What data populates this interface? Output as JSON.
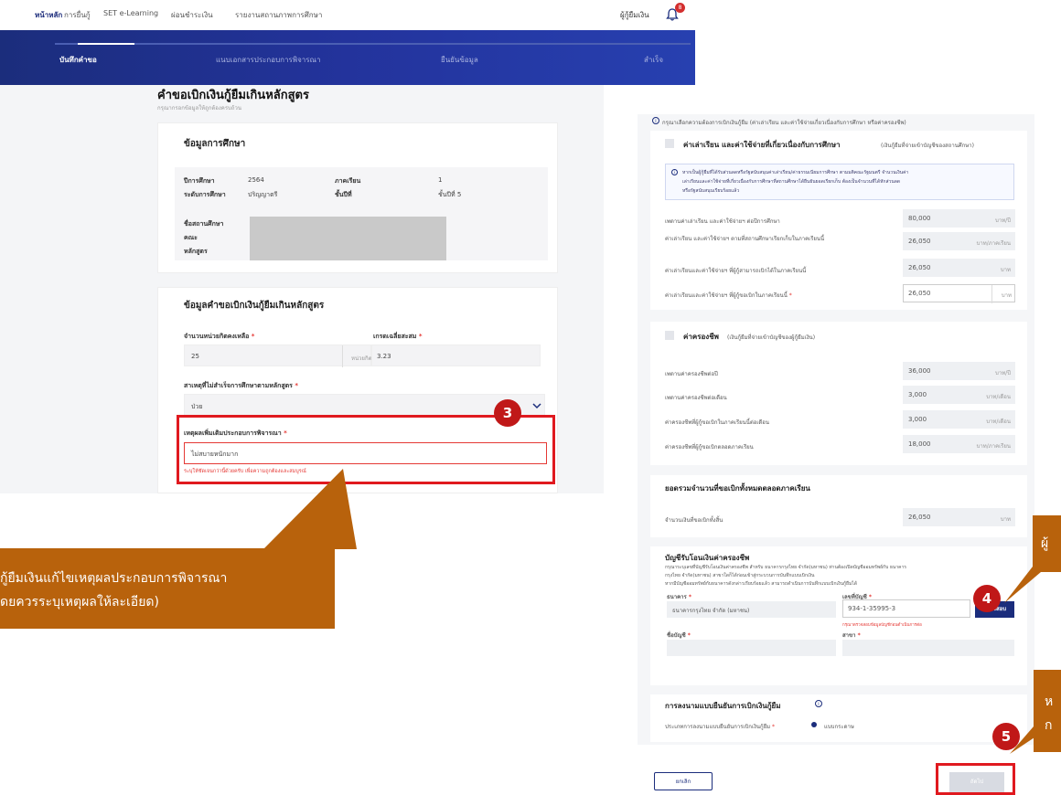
{
  "nav": {
    "items": [
      "หน้าหลัก",
      "การยื่นกู้",
      "SET e-Learning",
      "ผ่อนชำระเงิน",
      "รายงานสถานภาพการศึกษา"
    ],
    "user": "ผู้กู้ยืมเงิน",
    "badge": "8"
  },
  "stepper": {
    "steps": [
      "บันทึกคำขอ",
      "แนบเอกสารประกอบการพิจารณา",
      "ยืนยันข้อมูล",
      "สำเร็จ"
    ]
  },
  "form": {
    "title": "คำขอเบิกเงินกู้ยืมเกินหลักสูตร",
    "subtitle": "กรุณากรอกข้อมูลให้ถูกต้องครบถ้วน",
    "edu_card": {
      "title": "ข้อมูลการศึกษา",
      "year_label": "ปีการศึกษา",
      "year_value": "2564",
      "term_label": "ภาคเรียน",
      "term_value": "1",
      "level_label": "ระดับการศึกษา",
      "level_value": "ปริญญาตรี",
      "class_label": "ชั้นปีที่",
      "class_value": "ชั้นปีที่ 5",
      "inst_label": "ชื่อสถานศึกษา",
      "faculty_label": "คณะ",
      "program_label": "หลักสูตร"
    },
    "req_card": {
      "title": "ข้อมูลคำขอเบิกเงินกู้ยืมเกินหลักสูตร",
      "credits_label": "จำนวนหน่วยกิตคงเหลือ",
      "credits_value": "25",
      "credits_unit": "หน่วยกิต",
      "gpa_label": "เกรดเฉลี่ยสะสม",
      "gpa_value": "3.23",
      "reason_label": "สาเหตุที่ไม่สำเร็จการศึกษาตามหลักสูตร",
      "reason_value": "ป่วย",
      "extra_label": "เหตุผลเพิ่มเติมประกอบการพิจารณา",
      "extra_value": "ไม่สบายหนักมาก",
      "error_text": "ระบุให้ชัดเจนกว่านี้ด้วยครับ เพื่อความถูกต้องและสมบูรณ์"
    }
  },
  "callout3": {
    "number": "3",
    "line1": "กู้ยืมเงินแก้ไขเหตุผลประกอบการพิจารณา",
    "line2": "ดยควรระบุเหตุผลให้ละเอียด)"
  },
  "callout4": {
    "number": "4",
    "text": "ผู้"
  },
  "callout5": {
    "number": "5",
    "line1": "ห",
    "line2": "ก"
  },
  "right": {
    "info_note": "กรุณาเลือกความต้องการเบิกเงินกู้ยืม (ค่าเล่าเรียน และค่าใช้จ่ายเกี่ยวเนื่องกับการศึกษา หรือค่าครองชีพ)",
    "tuition": {
      "title": "ค่าเล่าเรียน และค่าใช้จ่ายที่เกี่ยวเนื่องกับการศึกษา",
      "title_note": "(เงินกู้ยืมที่จ่ายเข้าบัญชีของสถานศึกษา)",
      "info1": "หากเป็นผู้กู้ยืมที่ได้รับส่วนลดหรือรัฐสนับสนุนค่าเล่าเรียน/ค่าธรรมเนียมการศึกษา ตามมติคณะรัฐมนตรี จำนวนเงินค่า",
      "info2": "เล่าเรียนและค่าใช้จ่ายที่เกี่ยวเนื่องกับการศึกษาที่สถานศึกษาได้ยืนยันยอดเรียกเก็บ ต้องเป็นจำนวนที่ได้หักส่วนลด",
      "info3": "หรือรัฐสนับสนุนเรียบร้อยแล้ว",
      "rows": [
        {
          "label": "เพดานค่าเล่าเรียน และค่าใช้จ่ายฯ ต่อปีการศึกษา",
          "value": "80,000",
          "unit": "บาท/ปี"
        },
        {
          "label": "ค่าเล่าเรียน และค่าใช้จ่ายฯ ตามที่สถานศึกษาเรียกเก็บในภาคเรียนนี้",
          "value": "26,050",
          "unit": "บาท/ภาคเรียน"
        },
        {
          "label": "ค่าเล่าเรียนและค่าใช้จ่ายฯ ที่ผู้กู้สามารถเบิกได้ในภาคเรียนนี้",
          "value": "26,050",
          "unit": "บาท"
        },
        {
          "label": "ค่าเล่าเรียนและค่าใช้จ่ายฯ ที่ผู้กู้ขอเบิกในภาคเรียนนี้",
          "value": "26,050",
          "unit": "บาท"
        }
      ]
    },
    "living": {
      "title": "ค่าครองชีพ",
      "title_note": "(เงินกู้ยืมที่จ่ายเข้าบัญชีของผู้กู้ยืมเงิน)",
      "rows": [
        {
          "label": "เพดานค่าครองชีพต่อปี",
          "value": "36,000",
          "unit": "บาท/ปี"
        },
        {
          "label": "เพดานค่าครองชีพต่อเดือน",
          "value": "3,000",
          "unit": "บาท/เดือน"
        },
        {
          "label": "ค่าครองชีพที่ผู้กู้ขอเบิกในภาคเรียนนี้ต่อเดือน",
          "value": "3,000",
          "unit": "บาท/เดือน"
        },
        {
          "label": "ค่าครองชีพที่ผู้กู้ขอเบิกตลอดภาคเรียน",
          "value": "18,000",
          "unit": "บาท/ภาคเรียน"
        }
      ]
    },
    "total": {
      "title": "ยอดรวมจำนวนที่ขอเบิกทั้งหมดตลอดภาคเรียน",
      "label": "จำนวนเงินที่ขอเบิกทั้งสิ้น",
      "value": "26,050",
      "unit": "บาท"
    },
    "bank": {
      "title": "บัญชีรับโอนเงินค่าครองชีพ",
      "desc1": "กรุณาระบุเลขที่บัญชีรับโอนเงินค่าครองชีพ สำหรับ ธนาคารกรุงไทย จำกัด(มหาชน) ท่านต้องเปิดบัญชีออมทรัพย์กับ ธนาคาร",
      "desc2": "กรุงไทย จำกัด(มหาชน) สาขาใดก็ได้ก่อนเข้าสู่กระบวนการบันทึกแบบเบิกเงิน",
      "desc3": "หากมีบัญชีออมทรัพย์กับธนาคารดังกล่าวเรียบร้อยแล้ว สามารถดำเนินการบันทึกแบบเบิกเงินกู้ยืมได้",
      "bank_label": "ธนาคาร",
      "bank_value": "ธนาคารกรุงไทย จำกัด (มหาชน)",
      "acct_label": "เลขที่บัญชี",
      "acct_value": "934-1-35995-3",
      "verify_button": "ตรวจสอบ",
      "acct_hint": "กรุณาตรวจสอบข้อมูลบัญชีก่อนดำเนินการต่อ",
      "name_label": "ชื่อบัญชี",
      "branch_label": "สาขา"
    },
    "sign": {
      "title": "การลงนามแบบยืนยันการเบิกเงินกู้ยืม",
      "label": "ประเภทการลงนามแบบยืนยันการเบิกเงินกู้ยืม",
      "option": "แบบกระดาษ"
    },
    "cancel_button": "ยกเลิก",
    "next_button": "ถัดไป"
  }
}
